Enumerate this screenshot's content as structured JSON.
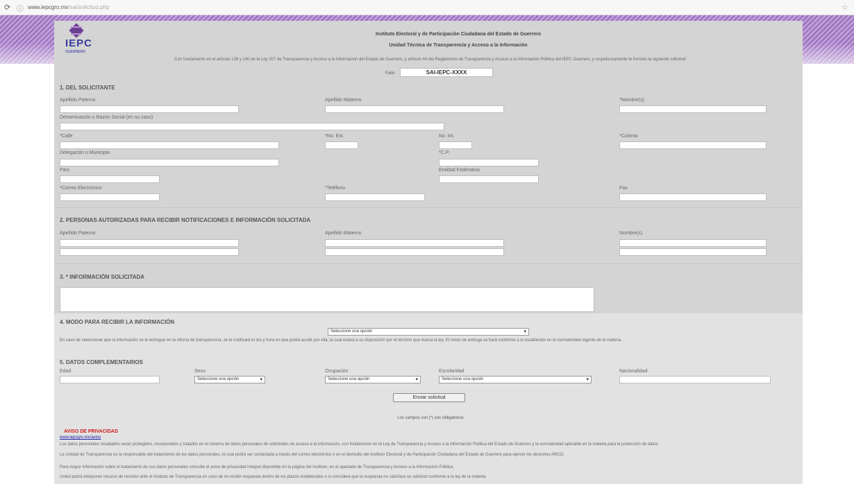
{
  "browser": {
    "url_host": "www.iepcgro.mx",
    "url_path": "/sai/solicitud.php",
    "nav_icon": "reload-icon",
    "info_icon": "info-icon",
    "star_icon": "star-icon"
  },
  "header": {
    "logo_text": "IEPC",
    "logo_sub": "GUERRERO",
    "title": "Instituto Electoral y de Participación Ciudadana del Estado de Guerrero",
    "subtitle": "Unidad Técnica de Transparencia y Acceso a la Información",
    "intro": "Con fundamento en el artículo 136 y 140 de la Ley 207 de Transparencia y Acceso a la Información del Estado de Guerrero, y artículo 44 del Reglamento de Transparencia y Acceso a la Información Pública del IEPC Guerrero, y respetuosamente le formulo la siguiente solicitud:",
    "folio_label": "Folio:",
    "folio_value": "SAI-IEPC-XXXX"
  },
  "section1": {
    "title": "1. DEL SOLICITANTE",
    "apellido_paterno": "Apellido Paterno",
    "apellido_materno": "Apellido Materno",
    "nombres": "*Nombre(s)",
    "denominacion": "Denominación o Razón Social (en su caso)",
    "calle": "*Calle",
    "no_ext": "*No. Ext.",
    "no_int": "No. Int.",
    "colonia": "*Colonia",
    "delegacion": "Delegación o Municipio",
    "cp": "*C.P.",
    "pais": "País",
    "entidad": "Entidad Federativa",
    "correo": "*Correo Electrónico",
    "telefono": "*Teléfono",
    "fax": "Fax"
  },
  "section2": {
    "title": "2. PERSONAS AUTORIZADAS PARA RECIBIR NOTIFICACIONES E INFORMACIÓN SOLICITADA",
    "apellido_paterno": "Apellido Paterno",
    "apellido_materno": "Apellido Materno",
    "nombres": "Nombre(s)"
  },
  "section3": {
    "title": "3. * INFORMACIÓN SOLICITADA"
  },
  "section4": {
    "title": "4. MODO PARA RECIBIR LA INFORMACIÓN",
    "select_value": "Seleccione una opción",
    "long_text": "En caso de seleccionar que la información se le entregue en la oficina de transparencia, se le notificará el día y hora en que podrá acudir por ella, la cual estará a su disposición por el término que marca la ley. El modo de entrega se hará conforme a lo establecido en la normatividad vigente de la materia.",
    "sub_title": "5. DATOS COMPLEMENTARIOS",
    "col1": "Edad",
    "col2": "Sexo",
    "col3": "Ocupación",
    "col4": "Escolaridad",
    "col5": "Nacionalidad",
    "select2": "Seleccione una opción",
    "select3": "Seleccione una opción",
    "select4": "Seleccione una opción",
    "button": "Enviar solicitud",
    "center_note": "Los campos con (*) son obligatorios",
    "red_note": "AVISO DE PRIVACIDAD",
    "link": "www.iepcgro.mx/aviso",
    "footer1": "Los datos personales recabados serán protegidos, incorporados y tratados en el sistema de datos personales de solicitudes de acceso a la información, con fundamento en la Ley de Transparencia y Acceso a la Información Pública del Estado de Guerrero y la normatividad aplicable en la materia para la protección de datos.",
    "footer2": "La Unidad de Transparencia es la responsable del tratamiento de los datos personales, la cual podrá ser contactada a través del correo electrónico o en el domicilio del Instituto Electoral y de Participación Ciudadana del Estado de Guerrero para ejercer los derechos ARCO.",
    "footer3": "Para mayor información sobre el tratamiento de sus datos personales consulte el aviso de privacidad integral disponible en la página del Instituto, en el apartado de Transparencia y Acceso a la Información Pública.",
    "footer4": "Usted podrá interponer recurso de revisión ante el Instituto de Transparencia en caso de no recibir respuesta dentro de los plazos establecidos o si considera que la respuesta no satisface su solicitud conforme a la ley de la materia."
  }
}
